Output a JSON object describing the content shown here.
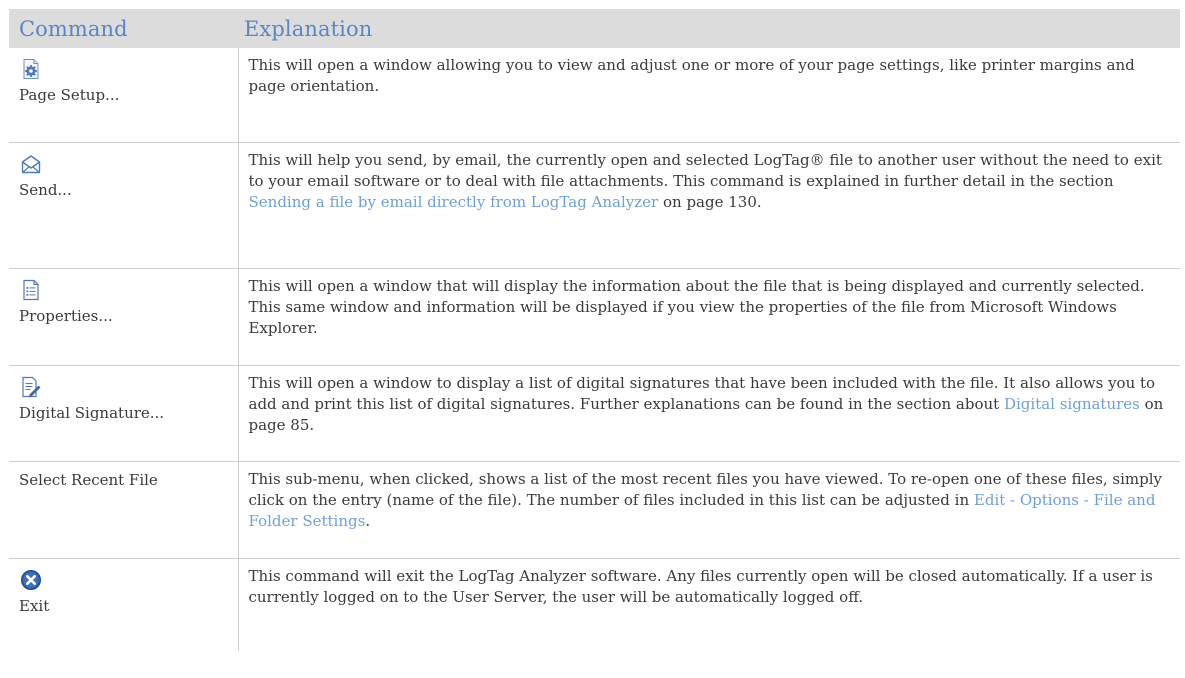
{
  "header": {
    "command": "Command",
    "explanation": "Explanation"
  },
  "rows": [
    {
      "command": "Page Setup...",
      "icon": "page-setup-gear-icon",
      "text": "This will open a window allowing you to view and adjust one or more of your page settings, like printer margins and page orientation."
    },
    {
      "command": "Send...",
      "icon": "envelope-icon",
      "text_before": "This will help you send, by email, the currently open and selected LogTag® file to another user without the need to exit to your email software or to deal with file attachments. This command is explained in further detail in the section ",
      "link": "Sending a file by email directly from LogTag Analyzer",
      "text_after": " on page 130."
    },
    {
      "command": "Properties...",
      "icon": "document-list-icon",
      "text": "This will open a window that will display the information about the file that is being displayed and currently selected. This same window and information will be displayed if you view the properties of the file from Microsoft Windows Explorer."
    },
    {
      "command": "Digital Signature...",
      "icon": "document-pen-icon",
      "text_before": "This will open a window to display a list of digital signatures that have been included with the file. It also allows you to add and print this list of digital signatures. Further explanations can be found in the section about ",
      "link": "Digital signatures",
      "text_after": "  on page 85."
    },
    {
      "command": "Select Recent File",
      "text_before": "This sub-menu, when clicked, shows a list of the most recent files you have viewed. To re-open one of these files, simply click on the entry (name of the file). The number of files included in this list can be adjusted in ",
      "link": "Edit - Options - File and Folder Settings",
      "text_after": "."
    },
    {
      "command": "Exit",
      "icon": "exit-x-circle-icon",
      "text": "This command will exit the LogTag Analyzer software. Any files currently open will be closed automatically. If a user is currently logged on to the User Server, the user will be automatically logged off."
    }
  ],
  "colors": {
    "header_bg": "#dcdcdc",
    "header_text": "#5a86c5",
    "link": "#6f9fd8",
    "body_text": "#3a3a3a"
  }
}
